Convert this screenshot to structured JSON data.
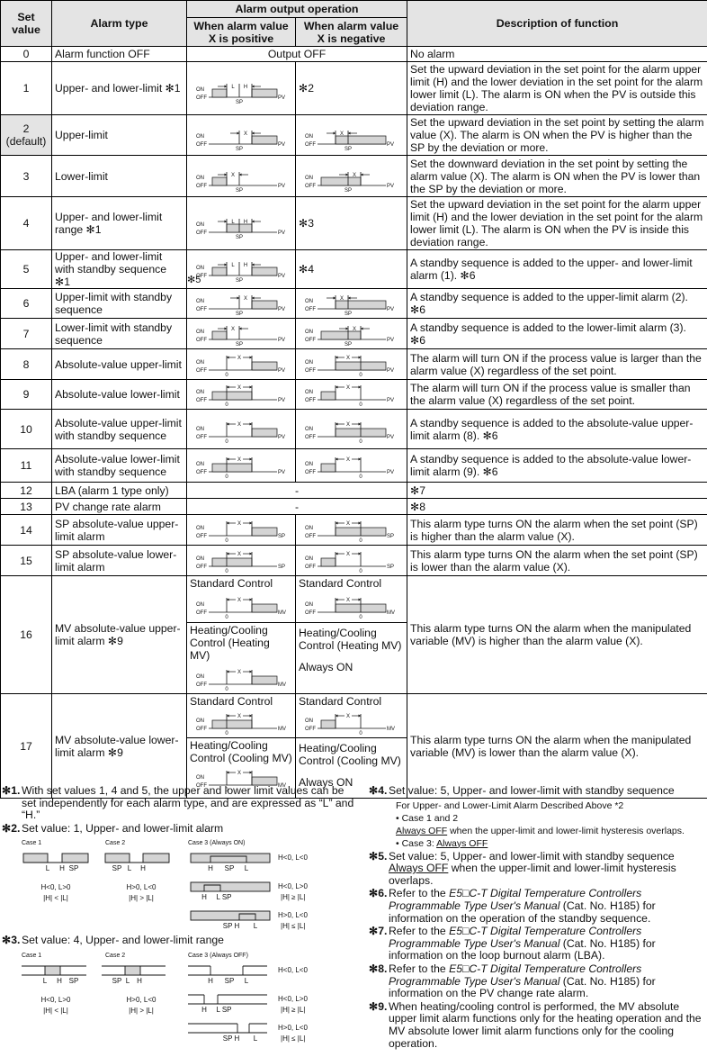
{
  "header": {
    "set_value": "Set value",
    "alarm_type": "Alarm type",
    "alarm_output_operation": "Alarm output operation",
    "when_positive": "When alarm value X is positive",
    "when_negative": "When alarm value X is negative",
    "description": "Description of function"
  },
  "diagram_labels": {
    "on": "ON",
    "off": "OFF",
    "pv": "PV",
    "sp": "SP",
    "mv": "MV",
    "zero": "0",
    "x": "X",
    "l": "L",
    "h": "H"
  },
  "rows": [
    {
      "set_value": "0",
      "alarm_type": "Alarm function OFF",
      "output": "Output OFF",
      "description": "No alarm"
    },
    {
      "set_value": "1",
      "alarm_type": "Upper- and lower-limit ✻1",
      "negative_note": "✻2",
      "description": "Set the upward deviation in the set point for the alarm upper limit (H) and the lower deviation in the set point for the alarm lower limit (L). The alarm is ON when the PV is outside this deviation range."
    },
    {
      "set_value": "2",
      "set_value_sub": "(default)",
      "alarm_type": "Upper-limit",
      "description": "Set the upward deviation in the set point by setting the alarm value (X). The alarm is ON when the PV is higher than the SP by the deviation or more."
    },
    {
      "set_value": "3",
      "alarm_type": "Lower-limit",
      "description": "Set the downward deviation in the set point by setting the alarm value (X). The alarm is ON when the PV is lower than the SP by the deviation or more."
    },
    {
      "set_value": "4",
      "alarm_type": "Upper- and lower-limit range ✻1",
      "negative_note": "✻3",
      "description": "Set the upward deviation in the set point for the alarm upper limit (H) and the lower deviation in the set point for the alarm lower limit (L). The alarm is ON when the PV is inside this deviation range."
    },
    {
      "set_value": "5",
      "alarm_type": "Upper- and lower-limit with standby sequence ✻1",
      "positive_note": "✻5",
      "negative_note": "✻4",
      "description": "A standby sequence is added to the upper- and lower-limit alarm (1). ✻6"
    },
    {
      "set_value": "6",
      "alarm_type": "Upper-limit with standby sequence",
      "description": "A standby sequence is added to the upper-limit alarm (2). ✻6"
    },
    {
      "set_value": "7",
      "alarm_type": "Lower-limit with standby sequence",
      "description": "A standby sequence is added to the lower-limit alarm (3). ✻6"
    },
    {
      "set_value": "8",
      "alarm_type": "Absolute-value upper-limit",
      "description": "The alarm will turn ON if the process value is larger than the alarm value (X) regardless of the set point."
    },
    {
      "set_value": "9",
      "alarm_type": "Absolute-value lower-limit",
      "description": "The alarm will turn ON if the process value is smaller than the alarm value (X) regardless of the set point."
    },
    {
      "set_value": "10",
      "alarm_type": "Absolute-value upper-limit with standby sequence",
      "description": "A standby sequence is added to the absolute-value upper-limit alarm (8). ✻6"
    },
    {
      "set_value": "11",
      "alarm_type": "Absolute-value lower-limit with standby sequence",
      "description": "A standby sequence is added to the absolute-value lower-limit alarm (9). ✻6"
    },
    {
      "set_value": "12",
      "alarm_type": "LBA (alarm 1 type only)",
      "output": "-",
      "description": "✻7"
    },
    {
      "set_value": "13",
      "alarm_type": "PV change rate alarm",
      "output": "-",
      "description": "✻8"
    },
    {
      "set_value": "14",
      "alarm_type": "SP absolute-value upper-limit alarm",
      "description": "This alarm type turns ON the alarm when the set point (SP) is higher than the alarm value (X)."
    },
    {
      "set_value": "15",
      "alarm_type": "SP absolute-value lower-limit alarm",
      "description": "This alarm type turns ON the alarm when the set point (SP) is lower than the alarm value (X)."
    },
    {
      "set_value": "16",
      "alarm_type": "MV absolute-value upper-limit alarm ✻9",
      "standard_control": "Standard Control",
      "hc_positive": "Heating/Cooling Control (Heating MV)",
      "hc_negative": "Heating/Cooling Control (Heating MV)",
      "hc_negative_state": "Always ON",
      "description": "This alarm type turns ON the alarm when the manipulated variable (MV) is higher than the alarm value (X)."
    },
    {
      "set_value": "17",
      "alarm_type": "MV absolute-value lower-limit alarm ✻9",
      "standard_control": "Standard Control",
      "hc_positive": "Heating/Cooling Control (Cooling MV)",
      "hc_negative": "Heating/Cooling Control (Cooling MV)",
      "hc_negative_state": "Always ON",
      "description": "This alarm type turns ON the alarm when the manipulated variable (MV) is lower than the alarm value (X)."
    }
  ],
  "notes": {
    "n1": {
      "mark": "✻1.",
      "text": "With set values 1, 4 and 5, the upper and lower limit values can be set  independently for each alarm type, and are expressed as “L” and “H.”"
    },
    "n2": {
      "mark": "✻2.",
      "text": "Set value: 1, Upper- and lower-limit alarm",
      "case1": "Case 1",
      "case2": "Case 2",
      "case3": "Case 3 (Always ON)",
      "case1_cond": "H<0, L>0",
      "case1_rel": "|H| < |L|",
      "case2_cond": "H>0, L<0",
      "case2_rel": "|H| > |L|",
      "case3a_cond": "H<0, L<0",
      "case3b_cond": "H<0, L>0",
      "case3b_rel": "|H| ≥ |L|",
      "case3c_cond": "H>0, L<0",
      "case3c_rel": "|H| ≤ |L|"
    },
    "n3": {
      "mark": "✻3.",
      "text": "Set value: 4, Upper- and lower-limit range",
      "case1": "Case 1",
      "case2": "Case 2",
      "case3": "Case 3 (Always OFF)",
      "case1_cond": "H<0, L>0",
      "case1_rel": "|H| < |L|",
      "case2_cond": "H>0, L<0",
      "case2_rel": "|H| > |L|",
      "case3a_cond": "H<0, L<0",
      "case3b_cond": "H<0, L>0",
      "case3b_rel": "|H| ≥ |L|",
      "case3c_cond": "H>0, L<0",
      "case3c_rel": "|H| ≤ |L|"
    },
    "n4": {
      "mark": "✻4.",
      "text": "Set value: 5, Upper- and lower-limit with standby sequence",
      "sub": "For Upper- and Lower-Limit Alarm Described Above *2",
      "bullet1": "Case 1 and 2",
      "bullet1_u": "Always OFF",
      "bullet1_rest": " when the upper-limit and lower-limit hysteresis overlaps.",
      "bullet2": "Case 3: ",
      "bullet2_u": "Always OFF"
    },
    "n5": {
      "mark": "✻5.",
      "text": "Set value: 5, Upper- and lower-limit with standby sequence",
      "u": "Always OFF",
      "rest": " when the upper-limit and lower-limit hysteresis overlaps."
    },
    "n6": {
      "mark": "✻6.",
      "pre": "Refer to the ",
      "title": "E5□C-T Digital Temperature Controllers Programmable Type User's Manual",
      "post": " (Cat. No. H185) for information on the operation of the standby sequence."
    },
    "n7": {
      "mark": "✻7.",
      "pre": "Refer to the ",
      "title": "E5□C-T Digital Temperature Controllers Programmable Type User's Manual",
      "post": " (Cat. No. H185)  for information on the loop burnout alarm (LBA)."
    },
    "n8": {
      "mark": "✻8.",
      "pre": "Refer to the ",
      "title": "E5□C-T Digital Temperature Controllers Programmable Type User's Manual",
      "post": " (Cat. No. H185) for information on the PV change rate alarm."
    },
    "n9": {
      "mark": "✻9.",
      "text": "When heating/cooling control is performed, the MV absolute upper limit alarm functions only for the heating operation and the MV absolute lower limit alarm functions only for the cooling operation."
    }
  }
}
